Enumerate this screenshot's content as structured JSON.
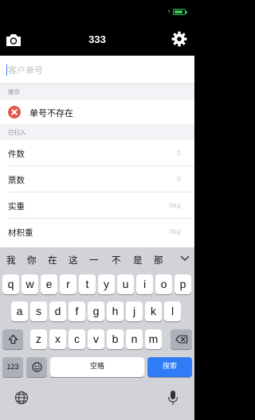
{
  "status": {
    "battery_color": "#35c759"
  },
  "nav": {
    "title": "333",
    "left_icon": "camera-icon",
    "right_icon": "gear-icon"
  },
  "search": {
    "placeholder": "客户单号",
    "value": ""
  },
  "hint_section": {
    "title": "提示",
    "message": "单号不存在",
    "icon": "error-icon",
    "icon_color": "#e15a4f"
  },
  "scanned_section": {
    "title": "已扫入",
    "rows": [
      {
        "label": "件数",
        "value": "0"
      },
      {
        "label": "票数",
        "value": "0"
      },
      {
        "label": "实重",
        "value": "0kg"
      },
      {
        "label": "材积重",
        "value": "0kg"
      }
    ]
  },
  "keyboard": {
    "candidates": [
      "我",
      "你",
      "在",
      "这",
      "一",
      "不",
      "是",
      "那"
    ],
    "row1": [
      "q",
      "w",
      "e",
      "r",
      "t",
      "y",
      "u",
      "i",
      "o",
      "p"
    ],
    "row2": [
      "a",
      "s",
      "d",
      "f",
      "g",
      "h",
      "j",
      "k",
      "l"
    ],
    "row3": [
      "z",
      "x",
      "c",
      "v",
      "b",
      "n",
      "m"
    ],
    "numbers_label": "123",
    "space_label": "空格",
    "search_label": "搜索",
    "accent_color": "#2f7cf6"
  }
}
